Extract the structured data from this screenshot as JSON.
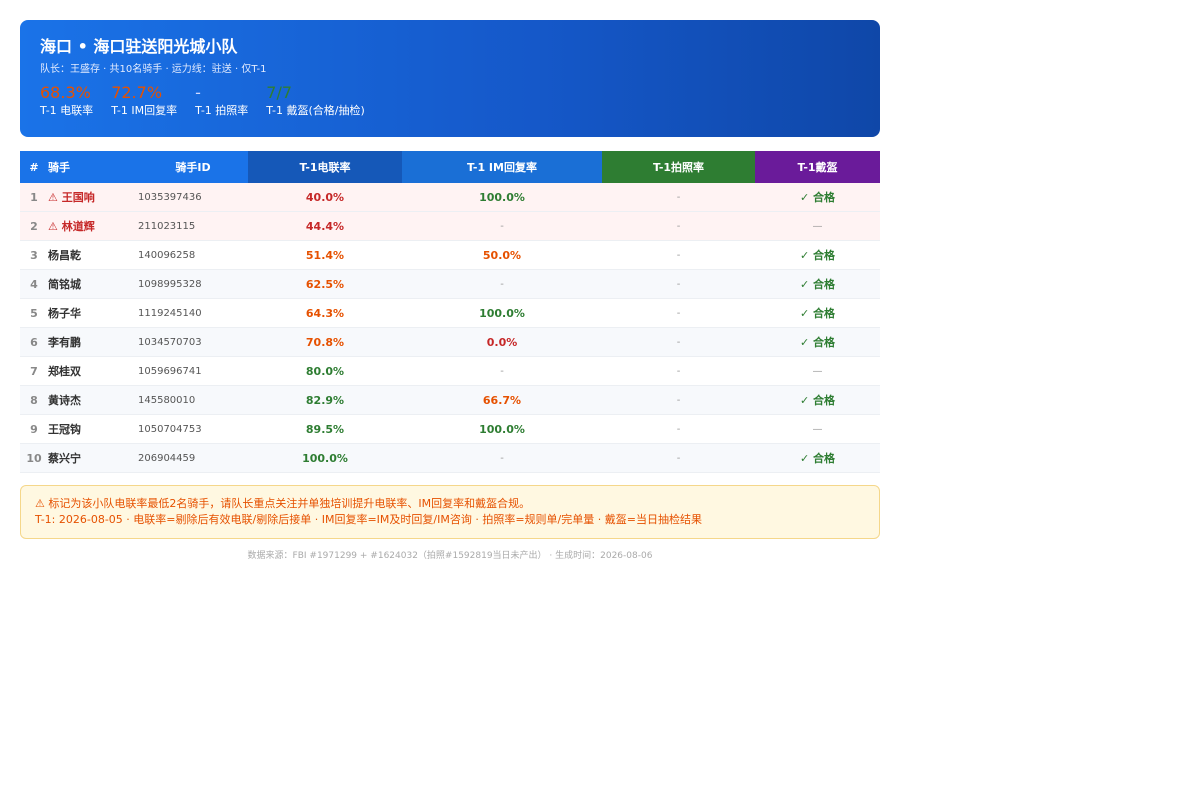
{
  "header": {
    "title": "海口 • 海口驻送阳光城小队",
    "subtitle": "队长：王盛存 · 共10名骑手 · 运力线：驻送 · 仅T-1",
    "metrics": [
      {
        "value": "68.3%",
        "label": "T-1 电联率",
        "color": "#e65100"
      },
      {
        "value": "72.7%",
        "label": "T-1 IM回复率",
        "color": "#e65100"
      },
      {
        "value": "-",
        "label": "T-1 拍照率",
        "color": "#cfd8ff"
      },
      {
        "value": "7/7",
        "label": "T-1 戴盔(合格/抽检)",
        "color": "#2e7d32"
      }
    ]
  },
  "table": {
    "columns": {
      "idx": "#",
      "name": "骑手",
      "id": "骑手ID",
      "call": "T-1电联率",
      "im": "T-1 IM回复率",
      "photo": "T-1拍照率",
      "helmet": "T-1戴盔"
    },
    "column_colors": {
      "base": "#1a73e8",
      "call": "#1558b8",
      "im": "#1a6fd6",
      "photo": "#2e7d32",
      "helmet": "#6a1b9a"
    },
    "rows": [
      {
        "idx": "1",
        "name": "⚠ 王国响",
        "id": "1035397436",
        "call": "40.0%",
        "call_color": "#c62828",
        "im": "100.0%",
        "im_color": "#2e7d32",
        "photo": "-",
        "helmet": "✓ 合格",
        "helmet_color": "#2e7d32",
        "alert": true
      },
      {
        "idx": "2",
        "name": "⚠ 林道辉",
        "id": "211023115",
        "call": "44.4%",
        "call_color": "#c62828",
        "im": "-",
        "im_color": "#999999",
        "photo": "-",
        "helmet": "—",
        "helmet_color": "#999999",
        "alert": true
      },
      {
        "idx": "3",
        "name": "杨昌乾",
        "id": "140096258",
        "call": "51.4%",
        "call_color": "#e65100",
        "im": "50.0%",
        "im_color": "#e65100",
        "photo": "-",
        "helmet": "✓ 合格",
        "helmet_color": "#2e7d32",
        "alert": false
      },
      {
        "idx": "4",
        "name": "简铭城",
        "id": "1098995328",
        "call": "62.5%",
        "call_color": "#e65100",
        "im": "-",
        "im_color": "#999999",
        "photo": "-",
        "helmet": "✓ 合格",
        "helmet_color": "#2e7d32",
        "alert": false
      },
      {
        "idx": "5",
        "name": "杨子华",
        "id": "1119245140",
        "call": "64.3%",
        "call_color": "#e65100",
        "im": "100.0%",
        "im_color": "#2e7d32",
        "photo": "-",
        "helmet": "✓ 合格",
        "helmet_color": "#2e7d32",
        "alert": false
      },
      {
        "idx": "6",
        "name": "李有鹏",
        "id": "1034570703",
        "call": "70.8%",
        "call_color": "#e65100",
        "im": "0.0%",
        "im_color": "#c62828",
        "photo": "-",
        "helmet": "✓ 合格",
        "helmet_color": "#2e7d32",
        "alert": false
      },
      {
        "idx": "7",
        "name": "郑桂双",
        "id": "1059696741",
        "call": "80.0%",
        "call_color": "#2e7d32",
        "im": "-",
        "im_color": "#999999",
        "photo": "-",
        "helmet": "—",
        "helmet_color": "#999999",
        "alert": false
      },
      {
        "idx": "8",
        "name": "黄诗杰",
        "id": "145580010",
        "call": "82.9%",
        "call_color": "#2e7d32",
        "im": "66.7%",
        "im_color": "#e65100",
        "photo": "-",
        "helmet": "✓ 合格",
        "helmet_color": "#2e7d32",
        "alert": false
      },
      {
        "idx": "9",
        "name": "王冠钩",
        "id": "1050704753",
        "call": "89.5%",
        "call_color": "#2e7d32",
        "im": "100.0%",
        "im_color": "#2e7d32",
        "photo": "-",
        "helmet": "—",
        "helmet_color": "#999999",
        "alert": false
      },
      {
        "idx": "10",
        "name": "蔡兴宁",
        "id": "206904459",
        "call": "100.0%",
        "call_color": "#2e7d32",
        "im": "-",
        "im_color": "#999999",
        "photo": "-",
        "helmet": "✓ 合格",
        "helmet_color": "#2e7d32",
        "alert": false
      }
    ]
  },
  "notice": {
    "line1": "⚠ 标记为该小队电联率最低2名骑手，请队长重点关注并单独培训提升电联率、IM回复率和戴盔合规。",
    "line2": "T-1: 2026-08-05 · 电联率=剔除后有效电联/剔除后接单 · IM回复率=IM及时回复/IM咨询 · 拍照率=规则单/完单量 · 戴盔=当日抽检结果"
  },
  "footer": "数据来源：FBI #1971299 + #1624032（拍照#1592819当日未产出） · 生成时间：2026-08-06"
}
